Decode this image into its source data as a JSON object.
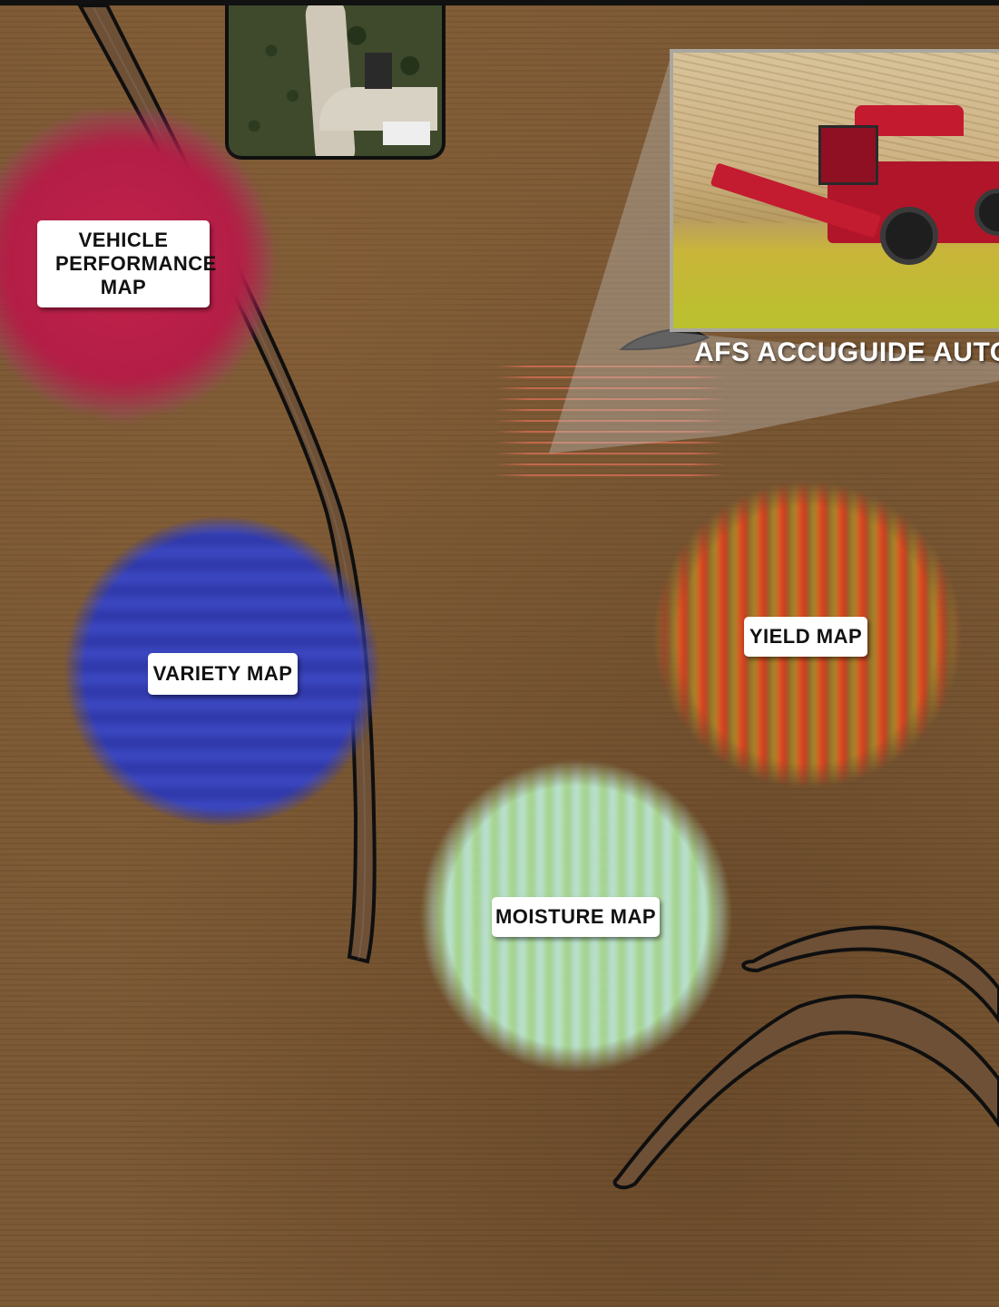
{
  "labels": {
    "vehicle_performance_map": "VEHICLE PERFORMANCE MAP",
    "variety_map": "VARIETY MAP",
    "yield_map": "YIELD MAP",
    "moisture_map": "MOISTURE MAP",
    "afs_accuguide": "AFS ACCUGUIDE AUTOGUI"
  },
  "colors": {
    "field_brown": "#7a5733",
    "vehicle_map_red": "#b01a34",
    "variety_map_blue": "#3340b5",
    "yield_map_red": "#d8402a",
    "moisture_map_white": "#f6f8f2",
    "label_bg": "#ffffff",
    "outline": "#0f0f0f"
  },
  "icons": {
    "farmstead": "aerial-farmstead-image",
    "harvester": "combine-harvester-photo"
  }
}
